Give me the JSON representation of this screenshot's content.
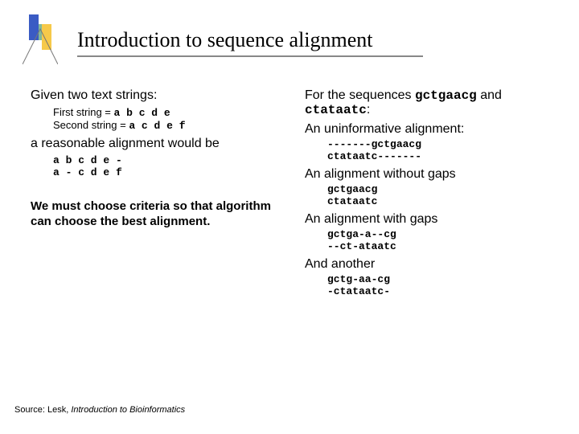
{
  "title": "Introduction to sequence alignment",
  "left": {
    "given": "Given two text strings:",
    "first_label": "First string = ",
    "first_val": "a b c d e",
    "second_label": "Second string = ",
    "second_val": "a c d e f",
    "reasonable": "a reasonable alignment would be",
    "align1": "a b c d e -",
    "align2": "a - c d e f",
    "criteria": "We must choose criteria so that algorithm can choose the best alignment."
  },
  "right": {
    "forseq_pre": "For the sequences ",
    "seq1": "gctgaacg",
    "forseq_mid": " and ",
    "seq2": "ctataatc",
    "forseq_post": ":",
    "uninf": "An uninformative alignment:",
    "uninf_l1": "-------gctgaacg",
    "uninf_l2": "ctataatc-------",
    "nogaps": "An alignment without gaps",
    "nogaps_l1": "gctgaacg",
    "nogaps_l2": "ctataatc",
    "withgaps": "An alignment with gaps",
    "withgaps_l1": "gctga-a--cg",
    "withgaps_l2": "--ct-ataatc",
    "another": "And another",
    "another_l1": "gctg-aa-cg",
    "another_l2": "-ctataatc-"
  },
  "footer": {
    "pre": "Source: Lesk, ",
    "title": "Introduction to Bioinformatics"
  }
}
